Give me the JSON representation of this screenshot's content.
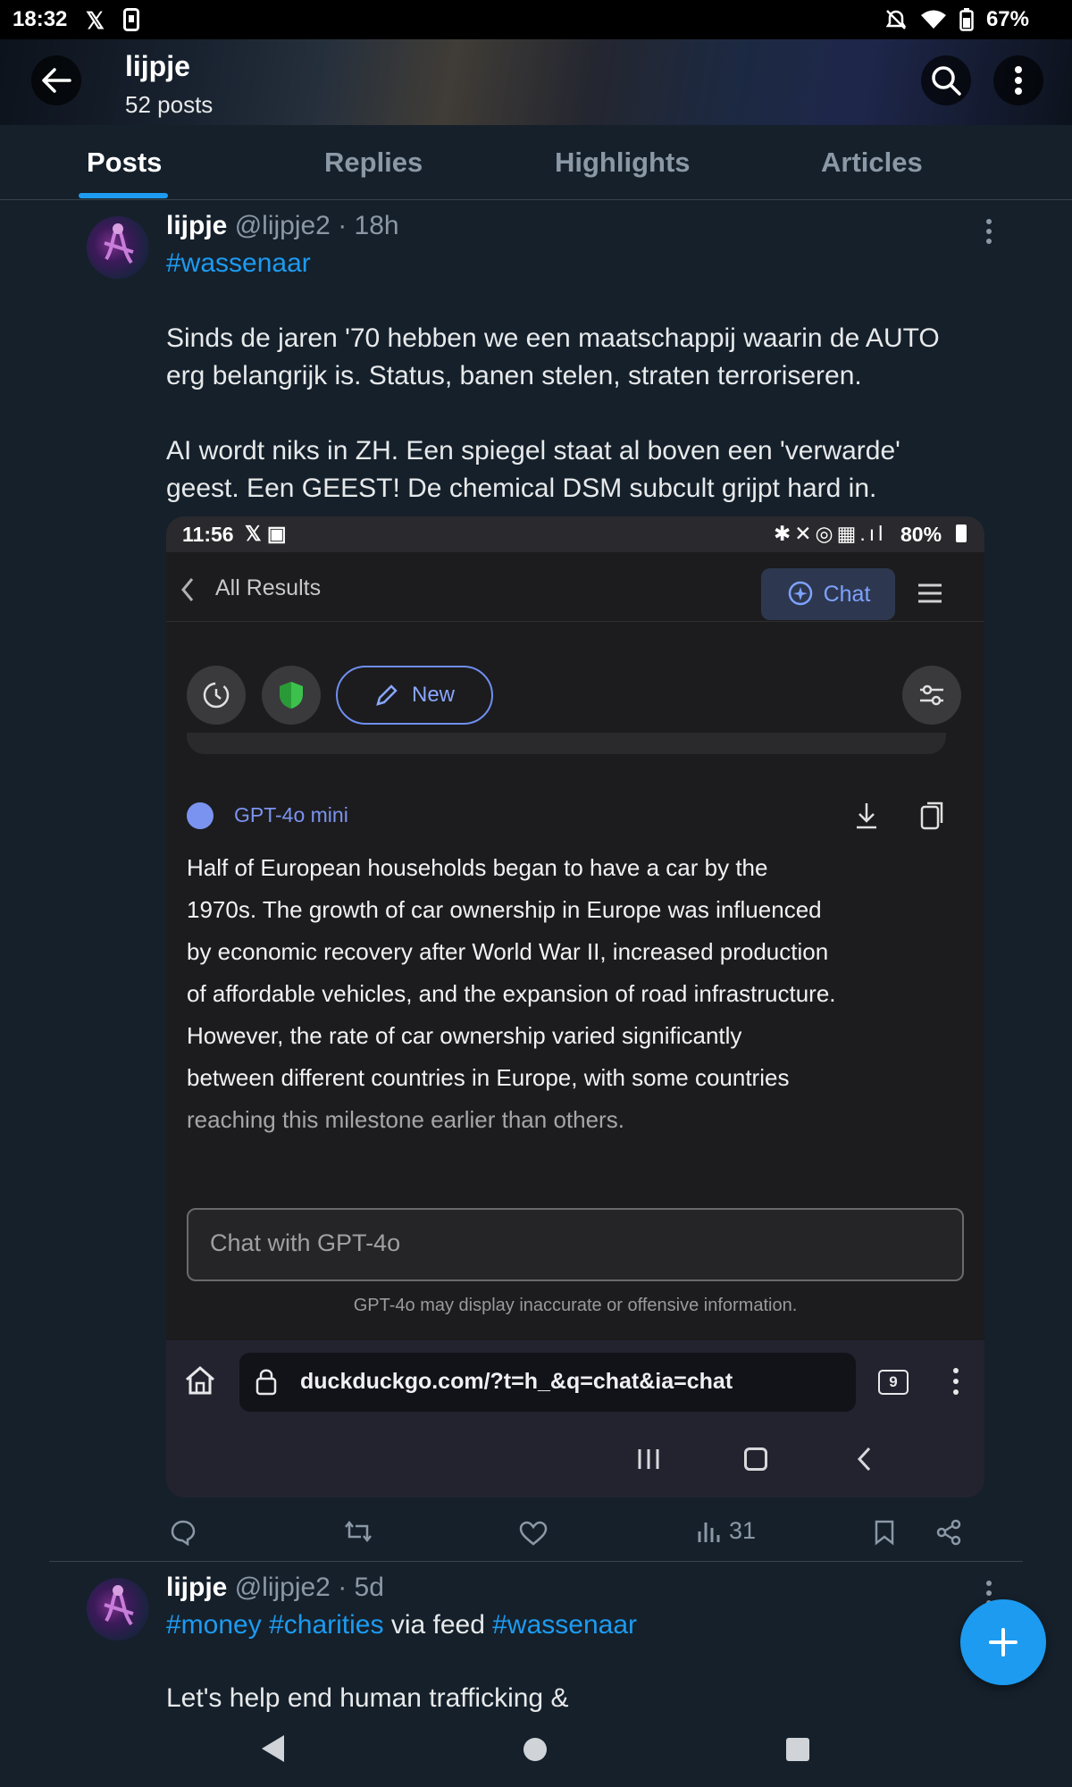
{
  "status_bar": {
    "time": "18:32",
    "battery": "67%"
  },
  "profile": {
    "name": "lijpje",
    "post_count": "52 posts"
  },
  "tabs": [
    {
      "label": "Posts"
    },
    {
      "label": "Replies"
    },
    {
      "label": "Highlights"
    },
    {
      "label": "Articles"
    }
  ],
  "post1": {
    "name": "lijpje",
    "handle": "@lijpje2",
    "time": "· 18h",
    "hashtag": "#wassenaar",
    "para1_line1": "Sinds de jaren '70 hebben we een maatschappij waarin de AUTO",
    "para1_line2": "erg belangrijk is. Status, banen stelen, straten terroriseren.",
    "para2_line1": "AI wordt niks in ZH. Een spiegel staat al boven een 'verwarde'",
    "para2_line2": "geest. Een GEEST! De chemical DSM subcult grijpt hard in.",
    "views": "31"
  },
  "screenshot": {
    "time": "11:56",
    "battery": "80%",
    "back_label": "All Results",
    "chat_label": "Chat",
    "new_label": "New",
    "model_label": "GPT-4o mini",
    "answer_lines": [
      "Half of European households began to have a car by the",
      "1970s. The growth of car ownership in Europe was influenced",
      "by economic recovery after World War II, increased production",
      "of affordable vehicles, and the expansion of road infrastructure.",
      "However, the rate of car ownership varied significantly",
      "between different countries in Europe, with some countries",
      "reaching this milestone earlier than others."
    ],
    "input_placeholder": "Chat with GPT-4o",
    "disclaimer": "GPT-4o may display inaccurate or offensive information.",
    "url": "duckduckgo.com/?t=h_&q=chat&ia=chat",
    "tab_count": "9"
  },
  "post2": {
    "name": "lijpje",
    "handle": "@lijpje2",
    "time": "· 5d",
    "tag1": "#money",
    "tag2": "#charities",
    "via_text": " via feed ",
    "tag3": "#wassenaar",
    "text": "Let's help end human trafficking &"
  },
  "colors": {
    "accent": "#1d9bf0",
    "background": "#15202b",
    "muted": "#8b98a5"
  }
}
